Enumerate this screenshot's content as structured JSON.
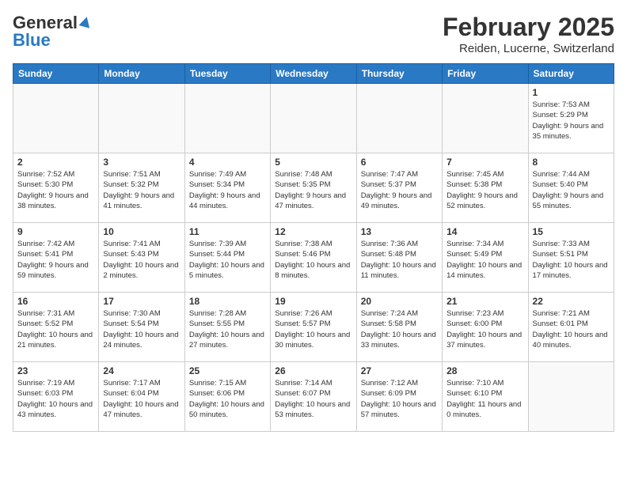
{
  "header": {
    "logo_general": "General",
    "logo_blue": "Blue",
    "month_title": "February 2025",
    "location": "Reiden, Lucerne, Switzerland"
  },
  "calendar": {
    "weekdays": [
      "Sunday",
      "Monday",
      "Tuesday",
      "Wednesday",
      "Thursday",
      "Friday",
      "Saturday"
    ],
    "weeks": [
      [
        {
          "day": "",
          "info": ""
        },
        {
          "day": "",
          "info": ""
        },
        {
          "day": "",
          "info": ""
        },
        {
          "day": "",
          "info": ""
        },
        {
          "day": "",
          "info": ""
        },
        {
          "day": "",
          "info": ""
        },
        {
          "day": "1",
          "info": "Sunrise: 7:53 AM\nSunset: 5:29 PM\nDaylight: 9 hours and 35 minutes."
        }
      ],
      [
        {
          "day": "2",
          "info": "Sunrise: 7:52 AM\nSunset: 5:30 PM\nDaylight: 9 hours and 38 minutes."
        },
        {
          "day": "3",
          "info": "Sunrise: 7:51 AM\nSunset: 5:32 PM\nDaylight: 9 hours and 41 minutes."
        },
        {
          "day": "4",
          "info": "Sunrise: 7:49 AM\nSunset: 5:34 PM\nDaylight: 9 hours and 44 minutes."
        },
        {
          "day": "5",
          "info": "Sunrise: 7:48 AM\nSunset: 5:35 PM\nDaylight: 9 hours and 47 minutes."
        },
        {
          "day": "6",
          "info": "Sunrise: 7:47 AM\nSunset: 5:37 PM\nDaylight: 9 hours and 49 minutes."
        },
        {
          "day": "7",
          "info": "Sunrise: 7:45 AM\nSunset: 5:38 PM\nDaylight: 9 hours and 52 minutes."
        },
        {
          "day": "8",
          "info": "Sunrise: 7:44 AM\nSunset: 5:40 PM\nDaylight: 9 hours and 55 minutes."
        }
      ],
      [
        {
          "day": "9",
          "info": "Sunrise: 7:42 AM\nSunset: 5:41 PM\nDaylight: 9 hours and 59 minutes."
        },
        {
          "day": "10",
          "info": "Sunrise: 7:41 AM\nSunset: 5:43 PM\nDaylight: 10 hours and 2 minutes."
        },
        {
          "day": "11",
          "info": "Sunrise: 7:39 AM\nSunset: 5:44 PM\nDaylight: 10 hours and 5 minutes."
        },
        {
          "day": "12",
          "info": "Sunrise: 7:38 AM\nSunset: 5:46 PM\nDaylight: 10 hours and 8 minutes."
        },
        {
          "day": "13",
          "info": "Sunrise: 7:36 AM\nSunset: 5:48 PM\nDaylight: 10 hours and 11 minutes."
        },
        {
          "day": "14",
          "info": "Sunrise: 7:34 AM\nSunset: 5:49 PM\nDaylight: 10 hours and 14 minutes."
        },
        {
          "day": "15",
          "info": "Sunrise: 7:33 AM\nSunset: 5:51 PM\nDaylight: 10 hours and 17 minutes."
        }
      ],
      [
        {
          "day": "16",
          "info": "Sunrise: 7:31 AM\nSunset: 5:52 PM\nDaylight: 10 hours and 21 minutes."
        },
        {
          "day": "17",
          "info": "Sunrise: 7:30 AM\nSunset: 5:54 PM\nDaylight: 10 hours and 24 minutes."
        },
        {
          "day": "18",
          "info": "Sunrise: 7:28 AM\nSunset: 5:55 PM\nDaylight: 10 hours and 27 minutes."
        },
        {
          "day": "19",
          "info": "Sunrise: 7:26 AM\nSunset: 5:57 PM\nDaylight: 10 hours and 30 minutes."
        },
        {
          "day": "20",
          "info": "Sunrise: 7:24 AM\nSunset: 5:58 PM\nDaylight: 10 hours and 33 minutes."
        },
        {
          "day": "21",
          "info": "Sunrise: 7:23 AM\nSunset: 6:00 PM\nDaylight: 10 hours and 37 minutes."
        },
        {
          "day": "22",
          "info": "Sunrise: 7:21 AM\nSunset: 6:01 PM\nDaylight: 10 hours and 40 minutes."
        }
      ],
      [
        {
          "day": "23",
          "info": "Sunrise: 7:19 AM\nSunset: 6:03 PM\nDaylight: 10 hours and 43 minutes."
        },
        {
          "day": "24",
          "info": "Sunrise: 7:17 AM\nSunset: 6:04 PM\nDaylight: 10 hours and 47 minutes."
        },
        {
          "day": "25",
          "info": "Sunrise: 7:15 AM\nSunset: 6:06 PM\nDaylight: 10 hours and 50 minutes."
        },
        {
          "day": "26",
          "info": "Sunrise: 7:14 AM\nSunset: 6:07 PM\nDaylight: 10 hours and 53 minutes."
        },
        {
          "day": "27",
          "info": "Sunrise: 7:12 AM\nSunset: 6:09 PM\nDaylight: 10 hours and 57 minutes."
        },
        {
          "day": "28",
          "info": "Sunrise: 7:10 AM\nSunset: 6:10 PM\nDaylight: 11 hours and 0 minutes."
        },
        {
          "day": "",
          "info": ""
        }
      ]
    ]
  }
}
